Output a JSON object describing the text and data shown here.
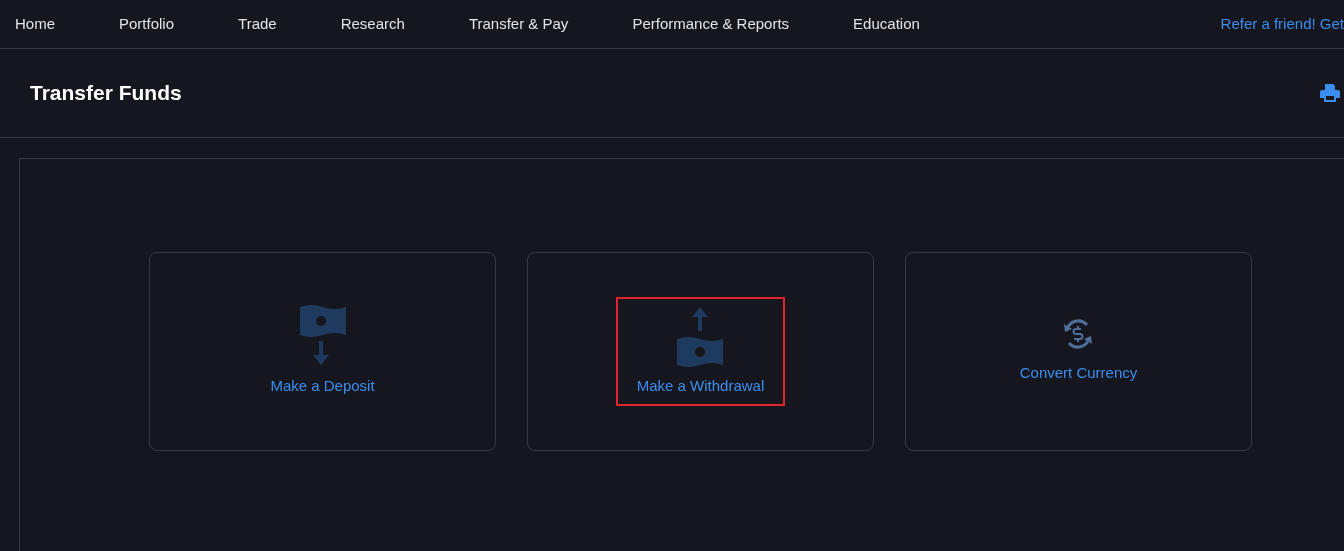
{
  "nav": {
    "items": [
      {
        "label": "Home"
      },
      {
        "label": "Portfolio"
      },
      {
        "label": "Trade"
      },
      {
        "label": "Research"
      },
      {
        "label": "Transfer & Pay"
      },
      {
        "label": "Performance & Reports"
      },
      {
        "label": "Education"
      }
    ],
    "promo": "Refer a friend! Get"
  },
  "page": {
    "title": "Transfer Funds"
  },
  "options": [
    {
      "kind": "deposit",
      "label": "Make a Deposit",
      "highlighted": false
    },
    {
      "kind": "withdrawal",
      "label": "Make a Withdrawal",
      "highlighted": true
    },
    {
      "kind": "convert",
      "label": "Convert Currency",
      "highlighted": false
    }
  ]
}
